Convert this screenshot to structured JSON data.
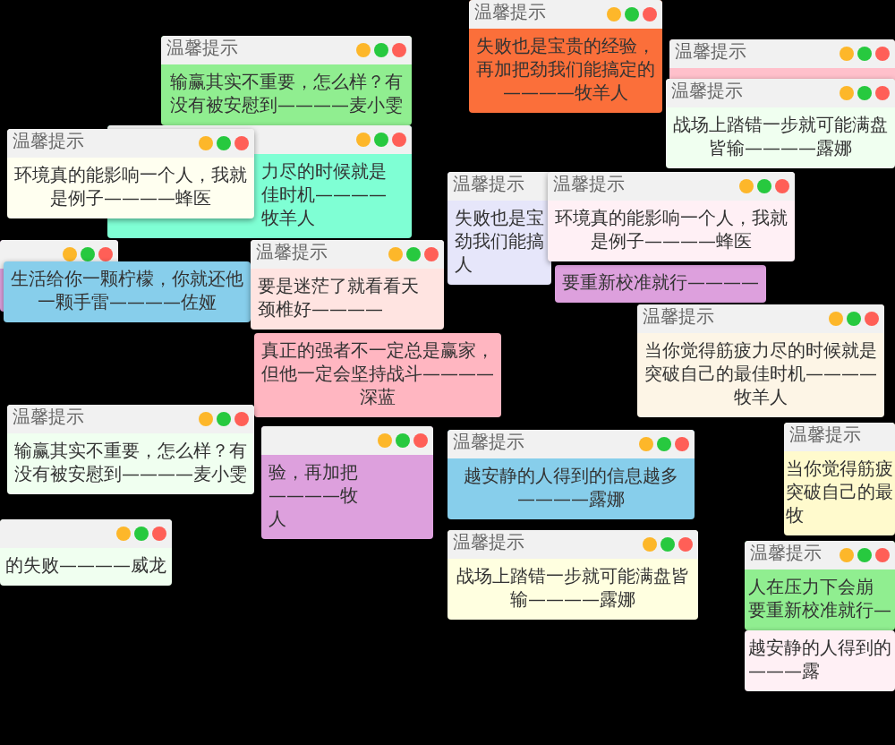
{
  "desktop": {
    "windows": [
      {
        "title": "温馨提示",
        "title_bar": true,
        "color": "#90ee90",
        "text": "输赢其实不重要，怎么样？有没有被安慰到————麦小雯"
      },
      {
        "title": "温馨提示",
        "title_bar": true,
        "color": "#fb6f3a",
        "text": "失败也是宝贵的经验，再加把劲我们能搞定的————牧羊人"
      },
      {
        "title": "温馨提示",
        "title_bar": true,
        "color": "#ffc0cb"
      },
      {
        "title": "温馨提示",
        "title_bar": true,
        "color": "#f0fff0",
        "text": "战场上踏错一步就可能满盘皆输————露娜"
      },
      {
        "title": "温馨提示",
        "title_bar": true,
        "color": "#fffff0",
        "text": "环境真的能影响一个人，我就是例子————蜂医"
      },
      {
        "title_bar": true,
        "color": "#7fffd4",
        "lines": [
          "力尽的时候就是",
          "佳时机————",
          "牧羊人"
        ]
      },
      {
        "title": "温馨提示",
        "title_bar": true,
        "color": "#e6e6fa",
        "lines": [
          "失败也是宝",
          "劲我们能搞",
          "人"
        ]
      },
      {
        "title": "温馨提示",
        "title_bar": true,
        "color": "#fff0f5",
        "text": "环境真的能影响一个人，我就是例子————蜂医"
      },
      {
        "title_bar": true,
        "color": "#dda0dd"
      },
      {
        "title_bar": false,
        "color": "#87ceeb",
        "text": "生活给你一颗柠檬，你就还他一颗手雷————佐娅"
      },
      {
        "title": "温馨提示",
        "title_bar": true,
        "color": "#ffe4e1",
        "lines": [
          "要是迷茫了就看看天",
          "颈椎好————"
        ]
      },
      {
        "title_bar": false,
        "color": "#dda0dd",
        "lines": [
          "要重新校准就行————"
        ]
      },
      {
        "title_bar": false,
        "color": "#ffb6c1",
        "text": "真正的强者不一定总是赢家，但他一定会坚持战斗————深蓝"
      },
      {
        "title": "温馨提示",
        "title_bar": true,
        "color": "#fdf5e6",
        "text": "当你觉得筋疲力尽的时候就是突破自己的最佳时机————牧羊人"
      },
      {
        "title": "温馨提示",
        "title_bar": true,
        "color": "#f0fff0",
        "text": "输赢其实不重要，怎么样？有没有被安慰到————麦小雯"
      },
      {
        "title_bar": true,
        "color": "#dda0dd",
        "lines": [
          "验，再加把",
          "————牧",
          "人"
        ]
      },
      {
        "title": "温馨提示",
        "title_bar": true,
        "color": "#87ceeb",
        "text": "越安静的人得到的信息越多————露娜"
      },
      {
        "title": "温馨提示",
        "title_bar": true,
        "color": "#fffacd",
        "lines": [
          "当你觉得筋疲",
          "突破自己的最",
          "牧"
        ]
      },
      {
        "title_bar": true,
        "color": "#f0fff0",
        "lines": [
          "的失败————威龙"
        ]
      },
      {
        "title": "温馨提示",
        "title_bar": true,
        "color": "#ffffe0",
        "text": "战场上踏错一步就可能满盘皆输————露娜"
      },
      {
        "title": "温馨提示",
        "title_bar": true,
        "color": "#90ee90",
        "lines": [
          "人在压力下会崩",
          "要重新校准就行—"
        ]
      },
      {
        "title_bar": false,
        "color": "#fff0f5",
        "lines": [
          "越安静的人得到的",
          "———露"
        ]
      }
    ]
  }
}
